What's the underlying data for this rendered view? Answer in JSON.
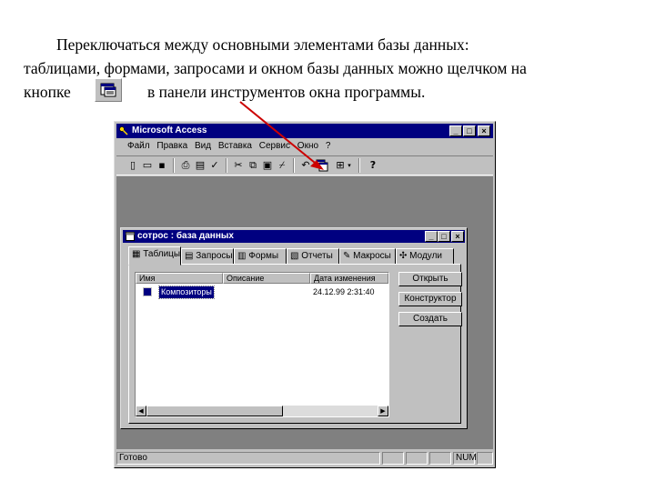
{
  "paragraph": {
    "line1": "Переключаться между основными элементами базы данных:",
    "line2": "таблицами, формами, запросами и окном базы данных можно щелчком на",
    "line3_before": "кнопке",
    "line3_after": "в панели инструментов окна программы."
  },
  "access_window": {
    "title": "Microsoft Access",
    "menu": [
      "Файл",
      "Правка",
      "Вид",
      "Вставка",
      "Сервис",
      "Окно",
      "?"
    ],
    "status_left": "Готово",
    "status_num": "NUM"
  },
  "db_window": {
    "title": "сотрос : база данных",
    "tabs": [
      "Таблицы",
      "Запросы",
      "Формы",
      "Отчеты",
      "Макросы",
      "Модули"
    ],
    "columns": [
      "Имя",
      "Описание",
      "Дата изменения"
    ],
    "rows": [
      {
        "name": "Композиторы",
        "date": "24.12.99 2:31:40"
      }
    ],
    "buttons": [
      "Открыть",
      "Конструктор",
      "Создать"
    ]
  },
  "colors": {
    "titlebar": "#000080",
    "arrow": "#cc0000",
    "chrome": "#c0c0c0"
  }
}
